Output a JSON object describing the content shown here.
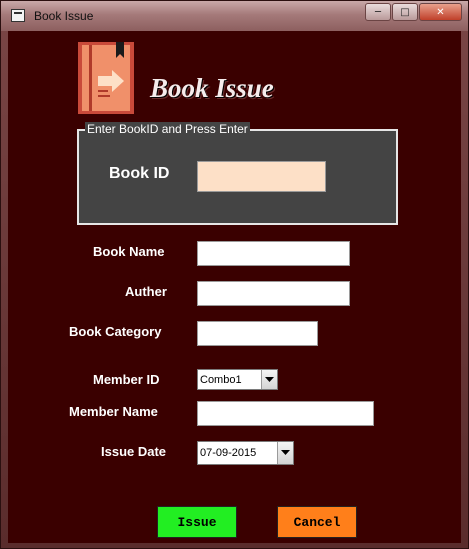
{
  "window": {
    "title": "Book Issue",
    "minimize_glyph": "─",
    "maximize_glyph": "□",
    "close_glyph": "✕"
  },
  "header": {
    "heading": "Book Issue",
    "logo_icon": "book-arrow-icon"
  },
  "group": {
    "legend": "Enter BookID and Press Enter",
    "book_id_label": "Book ID",
    "book_id_value": ""
  },
  "form": {
    "book_name_label": "Book Name",
    "book_name_value": "",
    "auther_label": "Auther",
    "auther_value": "",
    "book_category_label": "Book Category",
    "book_category_value": "",
    "member_id_label": "Member ID",
    "member_id_value": "Combo1",
    "member_name_label": "Member Name",
    "member_name_value": "",
    "issue_date_label": "Issue Date",
    "issue_date_value": "07-09-2015"
  },
  "buttons": {
    "issue": "Issue",
    "cancel": "Cancel"
  },
  "colors": {
    "background": "#3a0000",
    "issue_button": "#22ee22",
    "cancel_button": "#ff7f1a",
    "book_id_field": "#fde0c7",
    "group_box": "#444444"
  }
}
